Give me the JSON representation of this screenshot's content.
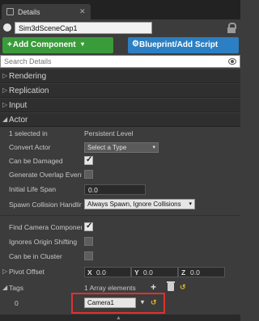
{
  "tab": {
    "title": "Details"
  },
  "object": {
    "name": "Sim3dSceneCap1"
  },
  "buttons": {
    "add_component_plus": "+",
    "add_component": "Add Component",
    "add_component_chevron": "▾",
    "blueprint_icon": "⚙",
    "blueprint": "Blueprint/Add Script"
  },
  "search": {
    "placeholder": "Search Details"
  },
  "categories": {
    "rendering": "Rendering",
    "replication": "Replication",
    "input": "Input",
    "actor": "Actor"
  },
  "actor": {
    "selected_label": "1 selected in",
    "selected_value": "Persistent Level",
    "convert_label": "Convert Actor",
    "convert_value": "Select a Type",
    "can_be_damaged_label": "Can be Damaged",
    "can_be_damaged": true,
    "overlap_label": "Generate Overlap Event",
    "overlap": false,
    "life_span_label": "Initial Life Span",
    "life_span_value": "0.0",
    "spawn_label": "Spawn Collision Handling",
    "spawn_value": "Always Spawn, Ignore Collisions",
    "find_camera_label": "Find Camera Component",
    "find_camera": true,
    "ignores_shift_label": "Ignores Origin Shifting",
    "ignores_shift": false,
    "cluster_label": "Can be in Cluster",
    "cluster": false,
    "pivot_label": "Pivot Offset",
    "pivot": {
      "x_letter": "X",
      "x": "0.0",
      "y_letter": "Y",
      "y": "0.0",
      "z_letter": "Z",
      "z": "0.0"
    },
    "tags_label": "Tags",
    "tags_count": "1 Array elements",
    "tag_index": "0",
    "tag_value": "Camera1"
  },
  "icons": {
    "checkmark": "✓",
    "chevron_down": "▾",
    "expanded": "◢",
    "collapsed": "▷",
    "reset": "↺",
    "plus": "+",
    "tab_close": "✕",
    "grip": "▲"
  },
  "colors": {
    "add_component": "#3a9b3a",
    "blueprint": "#2c7fc2",
    "highlight": "#e03030"
  }
}
